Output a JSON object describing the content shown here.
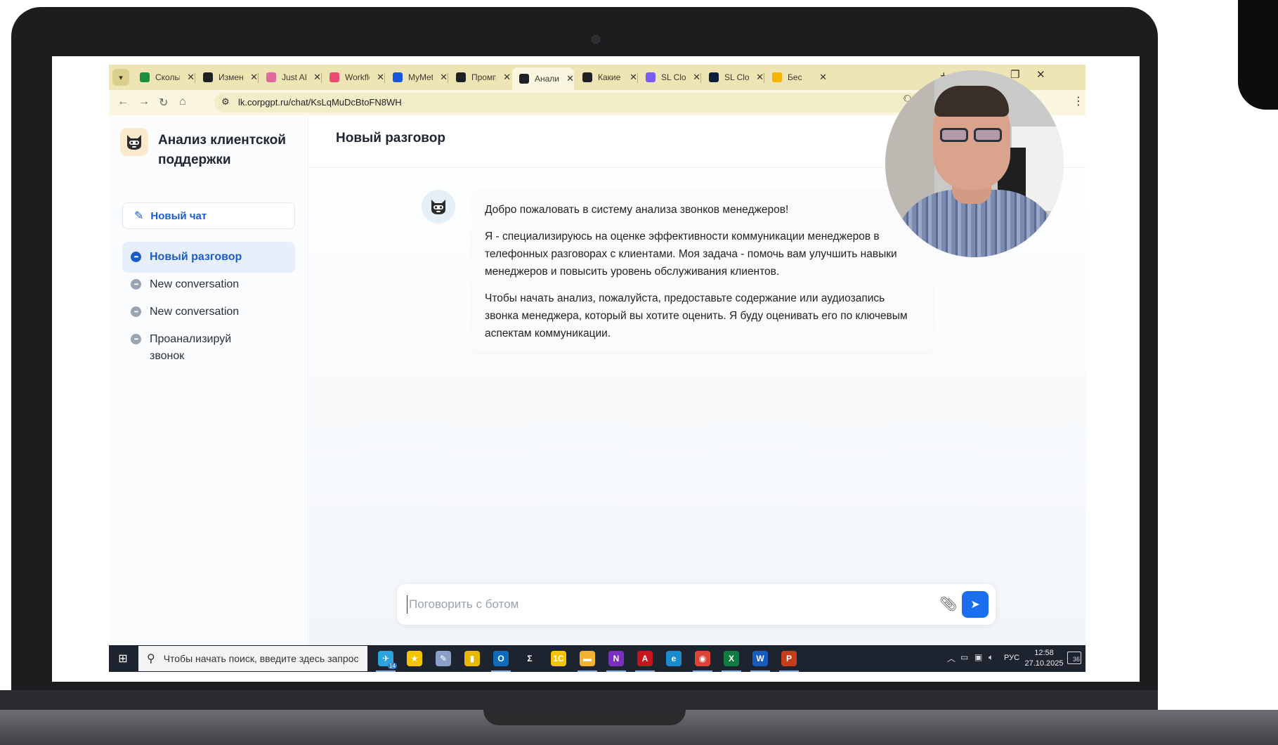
{
  "browser": {
    "tabs": [
      {
        "label": "Сколько",
        "favicon_color": "#1e8e3e",
        "active": false
      },
      {
        "label": "Измене",
        "favicon_color": "#202124",
        "active": false
      },
      {
        "label": "Just AI",
        "favicon_color": "#e06aa0",
        "active": false
      },
      {
        "label": "Workflo",
        "favicon_color": "#ea4b71",
        "active": false
      },
      {
        "label": "MyMeta",
        "favicon_color": "#1a56db",
        "active": false
      },
      {
        "label": "Промп",
        "favicon_color": "#202124",
        "active": false
      },
      {
        "label": "Анализ",
        "favicon_color": "#202124",
        "active": true
      },
      {
        "label": "Какие",
        "favicon_color": "#202124",
        "active": false
      },
      {
        "label": "SL Clou",
        "favicon_color": "#7b5cf0",
        "active": false
      },
      {
        "label": "SL Clou",
        "favicon_color": "#0b1f3a",
        "active": false
      },
      {
        "label": "Бес",
        "favicon_color": "#f4b400",
        "active": false
      }
    ],
    "url": "lk.corpgpt.ru/chat/KsLqMuDcBtoFN8WH"
  },
  "sidebar": {
    "app_title": "Анализ клиентской поддержки",
    "new_chat_label": "Новый чат",
    "conversations": [
      {
        "label": "Новый разговор",
        "active": true
      },
      {
        "label": "New conversation",
        "active": false
      },
      {
        "label": "New conversation",
        "active": false
      },
      {
        "label": "Проанализируй звонок",
        "active": false
      }
    ]
  },
  "main": {
    "title": "Новый разговор",
    "bot_message": {
      "paragraphs": [
        "Добро пожаловать в систему анализа звонков менеджеров!",
        "Я - специализируюсь на оценке эффективности коммуникации менеджеров в телефонных разговорах с клиентами. Моя задача - помочь вам улучшить навыки менеджеров и повысить уровень обслуживания клиентов.",
        "Чтобы начать анализ, пожалуйста, предоставьте содержание или аудиозапись звонка менеджера, который вы хотите оценить. Я буду оценивать его по ключевым аспектам коммуникации."
      ]
    },
    "composer": {
      "placeholder": "Поговорить с ботом",
      "value": ""
    }
  },
  "taskbar": {
    "search_placeholder": "Чтобы начать поиск, введите здесь запрос",
    "apps": [
      {
        "name": "telegram",
        "color": "#2aa3de",
        "glyph": "✈",
        "running": true,
        "badge": "14"
      },
      {
        "name": "favorites",
        "color": "#f5c400",
        "glyph": "★",
        "running": false
      },
      {
        "name": "paint",
        "color": "#8aa0c8",
        "glyph": "✎",
        "running": false
      },
      {
        "name": "notes",
        "color": "#e8b800",
        "glyph": "▮",
        "running": false
      },
      {
        "name": "outlook",
        "color": "#0f6cbd",
        "glyph": "O",
        "running": true
      },
      {
        "name": "sigma",
        "color": "#1d2430",
        "glyph": "Σ",
        "running": false
      },
      {
        "name": "1c",
        "color": "#f5c400",
        "glyph": "1С",
        "running": false
      },
      {
        "name": "file-explorer",
        "color": "#f2b12e",
        "glyph": "▬",
        "running": true
      },
      {
        "name": "onenote",
        "color": "#7b2fbe",
        "glyph": "N",
        "running": true
      },
      {
        "name": "acrobat",
        "color": "#c4161c",
        "glyph": "A",
        "running": true
      },
      {
        "name": "edge",
        "color": "#1a8bd0",
        "glyph": "e",
        "running": false
      },
      {
        "name": "chrome",
        "color": "#db4437",
        "glyph": "◉",
        "running": true
      },
      {
        "name": "excel",
        "color": "#107c41",
        "glyph": "X",
        "running": true
      },
      {
        "name": "word",
        "color": "#185abd",
        "glyph": "W",
        "running": true
      },
      {
        "name": "powerpoint",
        "color": "#c43e1c",
        "glyph": "P",
        "running": true
      }
    ],
    "language": "РУС",
    "time": "12:58",
    "date": "27.10.2025",
    "notification_count": "36"
  },
  "colors": {
    "tabstrip": "#eee5b4",
    "accent": "#1a6ff0",
    "active_conv": "#1a5cc8",
    "taskbar": "#1d2430"
  }
}
